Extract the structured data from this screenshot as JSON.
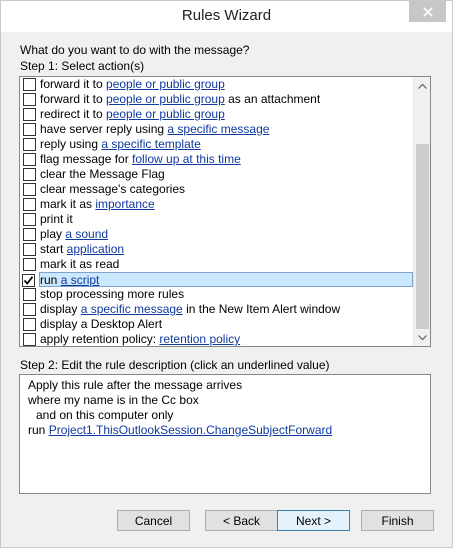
{
  "window": {
    "title": "Rules Wizard"
  },
  "question": "What do you want to do with the message?",
  "step1": {
    "label": "Step 1: Select action(s)"
  },
  "actions": [
    {
      "before": "forward it to ",
      "link": "people or public group",
      "after": "",
      "checked": false
    },
    {
      "before": "forward it to ",
      "link": "people or public group",
      "after": " as an attachment",
      "checked": false
    },
    {
      "before": "redirect it to ",
      "link": "people or public group",
      "after": "",
      "checked": false
    },
    {
      "before": "have server reply using ",
      "link": "a specific message",
      "after": "",
      "checked": false
    },
    {
      "before": "reply using ",
      "link": "a specific template",
      "after": "",
      "checked": false
    },
    {
      "before": "flag message for ",
      "link": "follow up at this time",
      "after": "",
      "checked": false
    },
    {
      "before": "clear the Message Flag",
      "link": "",
      "after": "",
      "checked": false
    },
    {
      "before": "clear message's categories",
      "link": "",
      "after": "",
      "checked": false
    },
    {
      "before": "mark it as ",
      "link": "importance",
      "after": "",
      "checked": false
    },
    {
      "before": "print it",
      "link": "",
      "after": "",
      "checked": false
    },
    {
      "before": "play ",
      "link": "a sound",
      "after": "",
      "checked": false
    },
    {
      "before": "start ",
      "link": "application",
      "after": "",
      "checked": false
    },
    {
      "before": "mark it as read",
      "link": "",
      "after": "",
      "checked": false
    },
    {
      "before": "run ",
      "link": "a script",
      "after": "",
      "checked": true,
      "selected": true
    },
    {
      "before": "stop processing more rules",
      "link": "",
      "after": "",
      "checked": false
    },
    {
      "before": "display ",
      "link": "a specific message",
      "after": " in the New Item Alert window",
      "checked": false
    },
    {
      "before": "display a Desktop Alert",
      "link": "",
      "after": "",
      "checked": false
    },
    {
      "before": "apply retention policy: ",
      "link": "retention policy",
      "after": "",
      "checked": false
    }
  ],
  "step2": {
    "label": "Step 2: Edit the rule description (click an underlined value)"
  },
  "description": [
    {
      "text": "Apply this rule after the message arrives",
      "link": "",
      "indent": 1
    },
    {
      "text": "where my name is in the Cc box",
      "link": "",
      "indent": 1
    },
    {
      "text": "and on this computer only",
      "link": "",
      "indent": 2
    },
    {
      "text": "run ",
      "link": "Project1.ThisOutlookSession.ChangeSubjectForward",
      "indent": 0
    }
  ],
  "buttons": {
    "cancel": "Cancel",
    "back": "< Back",
    "next": "Next >",
    "finish": "Finish"
  },
  "icons": {
    "close": "close-icon",
    "check": "checkmark-icon",
    "scroll_up": "chevron-up-icon",
    "scroll_down": "chevron-down-icon"
  },
  "colors": {
    "link": "#0f3a9e",
    "selection": "#cce8ff",
    "close_button": "#c7c7c7"
  }
}
